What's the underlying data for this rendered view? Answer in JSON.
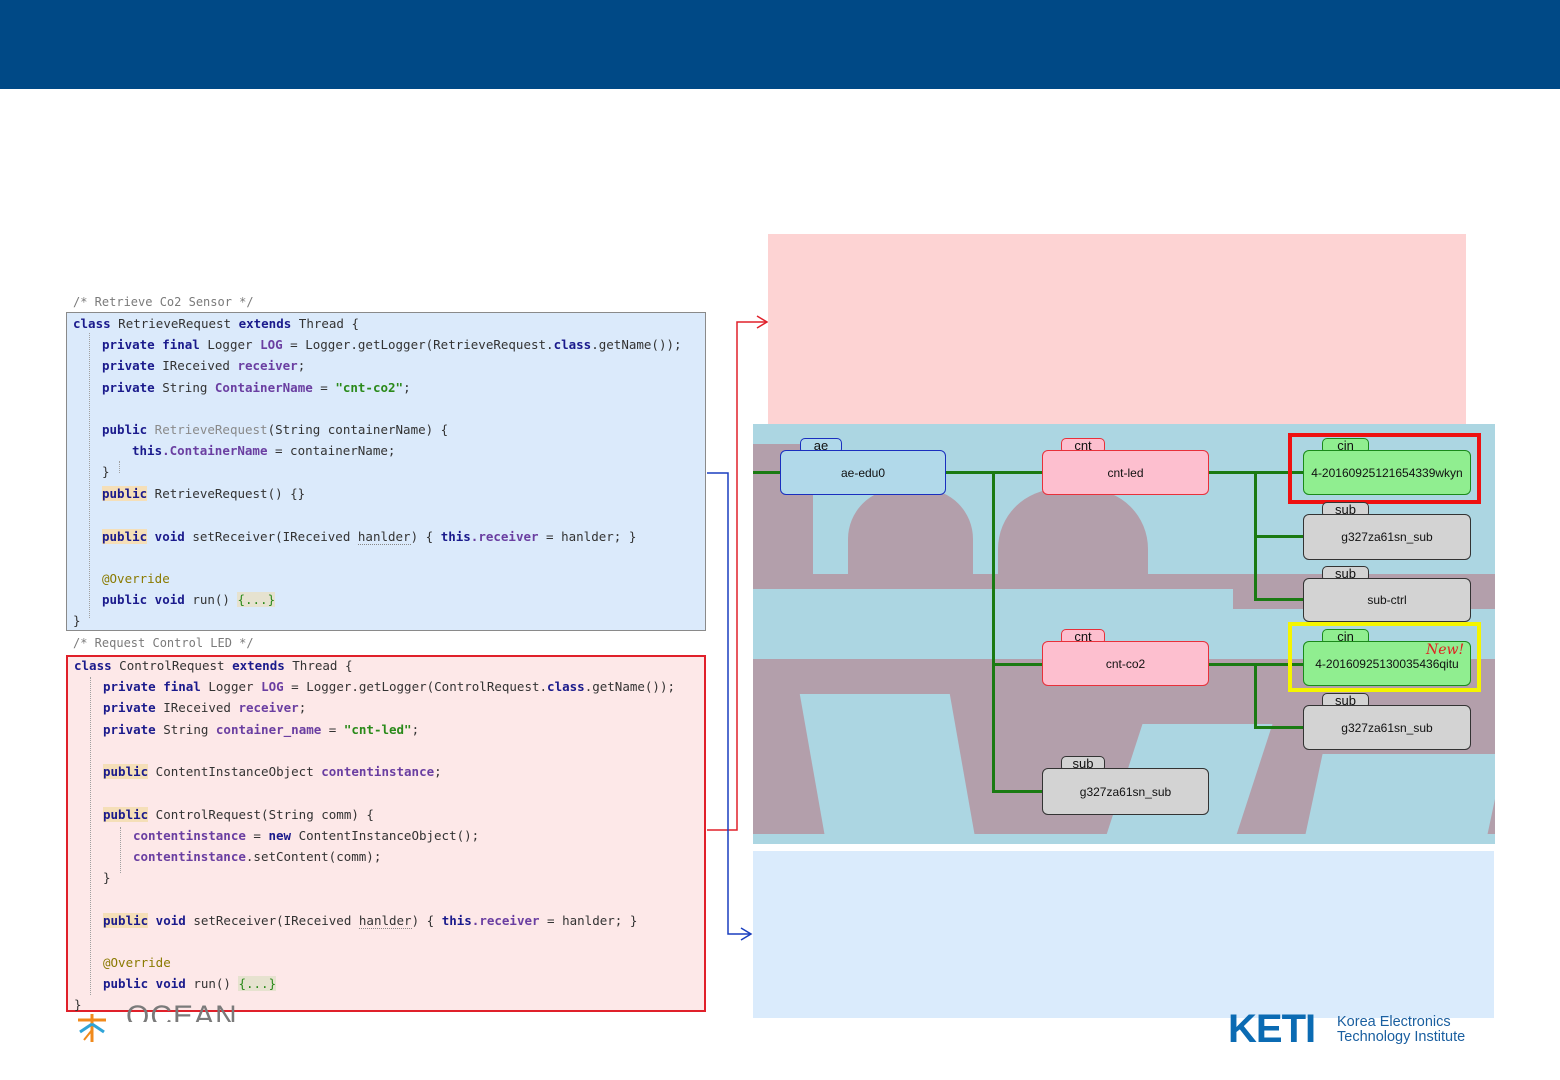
{
  "comments": {
    "retrieve": "/* Retrieve Co2 Sensor */",
    "control": "/* Request Control LED */"
  },
  "code_retrieve": {
    "l1": {
      "k1": "class",
      "n1": " RetrieveRequest ",
      "k2": "extends",
      "n2": " Thread {"
    },
    "l2": {
      "k1": "private final",
      "n1": " Logger ",
      "f1": "LOG",
      "n2": " = Logger.getLogger(RetrieveRequest.",
      "k2": "class",
      "n3": ".getName());"
    },
    "l3": {
      "k1": "private",
      "n1": " IReceived ",
      "f1": "receiver",
      "n2": ";"
    },
    "l4": {
      "k1": "private",
      "n1": " String ",
      "f1": "ContainerName",
      "n2": " = ",
      "s1": "\"cnt-co2\"",
      "n3": ";"
    },
    "l5": {
      "k1": "public",
      "c1": " RetrieveRequest",
      "n1": "(String containerName) {"
    },
    "l6": {
      "k1": "this",
      "f1": ".ContainerName",
      "n1": " = containerName;"
    },
    "l7": {
      "n1": "}"
    },
    "l8": {
      "k1": "public",
      "n1": " RetrieveRequest() {}"
    },
    "l9": {
      "k1": "public",
      "k2": " void",
      "n1": " setReceiver(IReceived ",
      "n2": "hanlder",
      "n3": ") { ",
      "k3": "this",
      "f1": ".receiver",
      "n4": " = hanlder; }"
    },
    "l10": {
      "a1": "@Override"
    },
    "l11": {
      "k1": "public void",
      "n1": " run() ",
      "fd": "{...}"
    },
    "l12": {
      "n1": "}"
    }
  },
  "code_control": {
    "l1": {
      "k1": "class",
      "n1": " ControlRequest ",
      "k2": "extends",
      "n2": " Thread {"
    },
    "l2": {
      "k1": "private final",
      "n1": " Logger ",
      "f1": "LOG",
      "n2": " = Logger.getLogger(ControlRequest.",
      "k2": "class",
      "n3": ".getName());"
    },
    "l3": {
      "k1": "private",
      "n1": " IReceived ",
      "f1": "receiver",
      "n2": ";"
    },
    "l4": {
      "k1": "private",
      "n1": " String ",
      "f1": "container_name",
      "n2": " = ",
      "s1": "\"cnt-led\"",
      "n3": ";"
    },
    "l5": {
      "k1": "public",
      "n1": " ContentInstanceObject ",
      "f1": "contentinstance",
      "n2": ";"
    },
    "l6": {
      "k1": "public",
      "n1": " ControlRequest(String comm) {"
    },
    "l7": {
      "f1": "contentinstance",
      "n1": " = ",
      "k1": "new",
      "n2": " ContentInstanceObject();"
    },
    "l8": {
      "f1": "contentinstance",
      "n1": ".setContent(comm);"
    },
    "l9": {
      "n1": "}"
    },
    "l10": {
      "k1": "public",
      "k2": " void",
      "n1": " setReceiver(IReceived ",
      "n2": "hanlder",
      "n3": ") { ",
      "k3": "this",
      "f1": ".receiver",
      "n4": " = hanlder; }"
    },
    "l11": {
      "a1": "@Override"
    },
    "l12": {
      "k1": "public void",
      "n1": " run() ",
      "fd": "{...}"
    },
    "l13": {
      "n1": "}"
    }
  },
  "tree": {
    "ae": {
      "tag": "ae",
      "label": "ae-edu0"
    },
    "cnt_led": {
      "tag": "cnt",
      "label": "cnt-led"
    },
    "cnt_co2": {
      "tag": "cnt",
      "label": "cnt-co2"
    },
    "cin_led": {
      "tag": "cin",
      "label": "4-20160925121654339wkyn"
    },
    "sub_led": {
      "tag": "sub",
      "label": "g327za61sn_sub"
    },
    "sub_ctrl": {
      "tag": "sub",
      "label": "sub-ctrl"
    },
    "cin_co2": {
      "tag": "cin",
      "label": "4-20160925130035436qitu",
      "badge": "New!"
    },
    "sub_co2": {
      "tag": "sub",
      "label": "g327za61sn_sub"
    },
    "sub_ae": {
      "tag": "sub",
      "label": "g327za61sn_sub"
    }
  },
  "logos": {
    "ocean": "OCEAN",
    "keti_abbr": "KETI",
    "keti_line1": "Korea Electronics",
    "keti_line2": "Technology Institute"
  },
  "colors": {
    "header": "#004986",
    "code_blue_bg": "#dbeafb",
    "code_red_bg": "#fde8e8",
    "tree_bg": "#acd6e2",
    "highlight_red": "#ee1111",
    "highlight_yellow": "#f5f500"
  }
}
